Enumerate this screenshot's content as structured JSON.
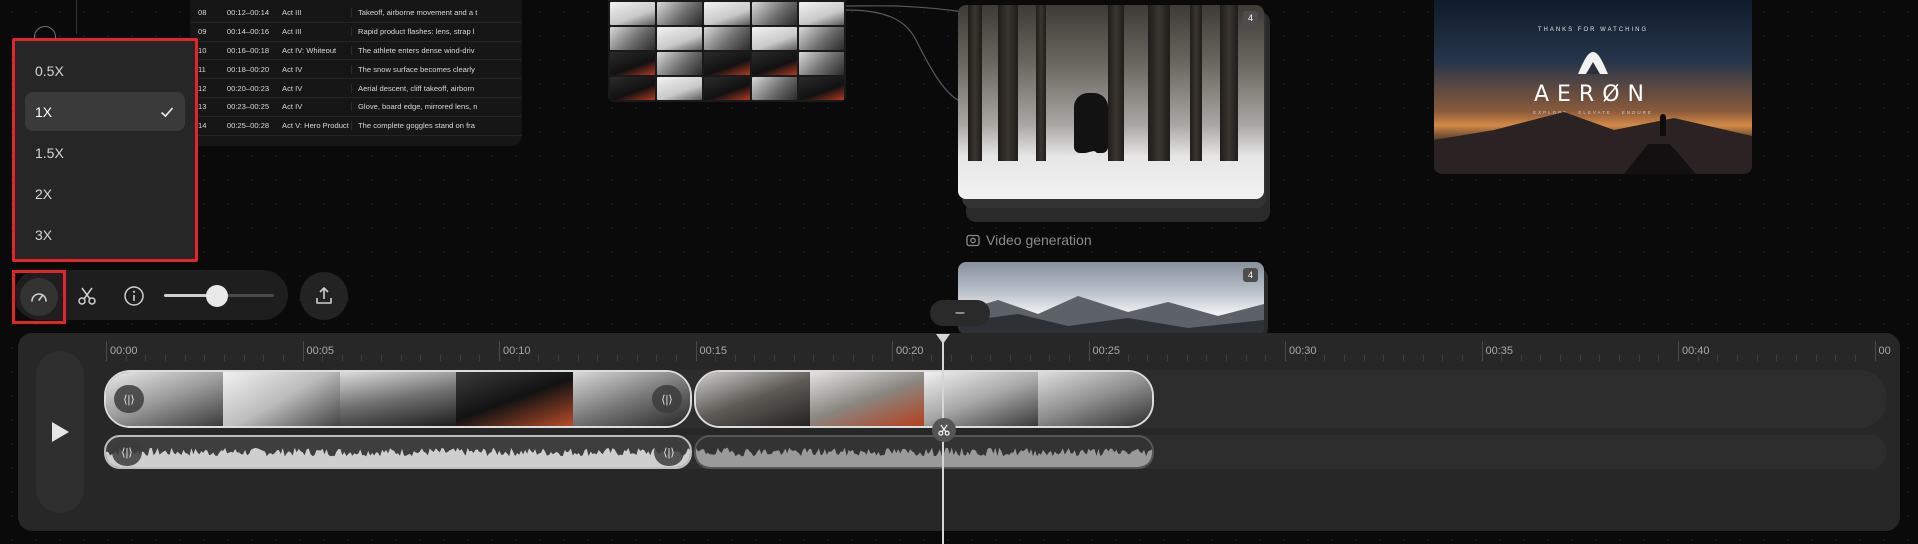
{
  "script_table": {
    "rows": [
      {
        "num": "08",
        "time": "00:12–00:14",
        "act": "Act III",
        "desc": "Takeoff, airborne movement and a t"
      },
      {
        "num": "09",
        "time": "00:14–00:16",
        "act": "Act III",
        "desc": "Rapid product flashes: lens, strap l"
      },
      {
        "num": "10",
        "time": "00:16–00:18",
        "act": "Act IV: Whiteout",
        "desc": "The athlete enters dense wind-driv"
      },
      {
        "num": "11",
        "time": "00:18–00:20",
        "act": "Act IV",
        "desc": "The snow surface becomes clearly"
      },
      {
        "num": "12",
        "time": "00:20–00:23",
        "act": "Act IV",
        "desc": "Aerial descent, cliff takeoff, airborn"
      },
      {
        "num": "13",
        "time": "00:23–00:25",
        "act": "Act IV",
        "desc": "Glove, board edge, mirrored lens, n"
      },
      {
        "num": "14",
        "time": "00:25–00:28",
        "act": "Act V: Hero Product",
        "desc": "The complete goggles stand on fra"
      }
    ]
  },
  "video_cards": {
    "card1_badge": "4",
    "section_label": "Video generation",
    "card2_badge": "4"
  },
  "end_card": {
    "thanks": "THANKS FOR WATCHING",
    "brand": "AERØN",
    "tagline": "EXPLORE · ELEVATE · ENDURE"
  },
  "speed_menu": {
    "options": [
      {
        "label": "0.5X",
        "selected": false
      },
      {
        "label": "1X",
        "selected": true
      },
      {
        "label": "1.5X",
        "selected": false
      },
      {
        "label": "2X",
        "selected": false
      },
      {
        "label": "3X",
        "selected": false
      }
    ]
  },
  "controls": {
    "volume_level": 0.48,
    "collapse_label": "–"
  },
  "timeline": {
    "ticks": [
      "00:00",
      "00:05",
      "00:10",
      "00:15",
      "00:20",
      "00:25",
      "00:30",
      "00:35",
      "00:40",
      "00"
    ],
    "handle_label": "⟨|⟩",
    "playhead_time_seconds": 21.3
  },
  "colors": {
    "highlight": "#e0262c",
    "panel": "#272727",
    "background": "#0a0a0a"
  }
}
